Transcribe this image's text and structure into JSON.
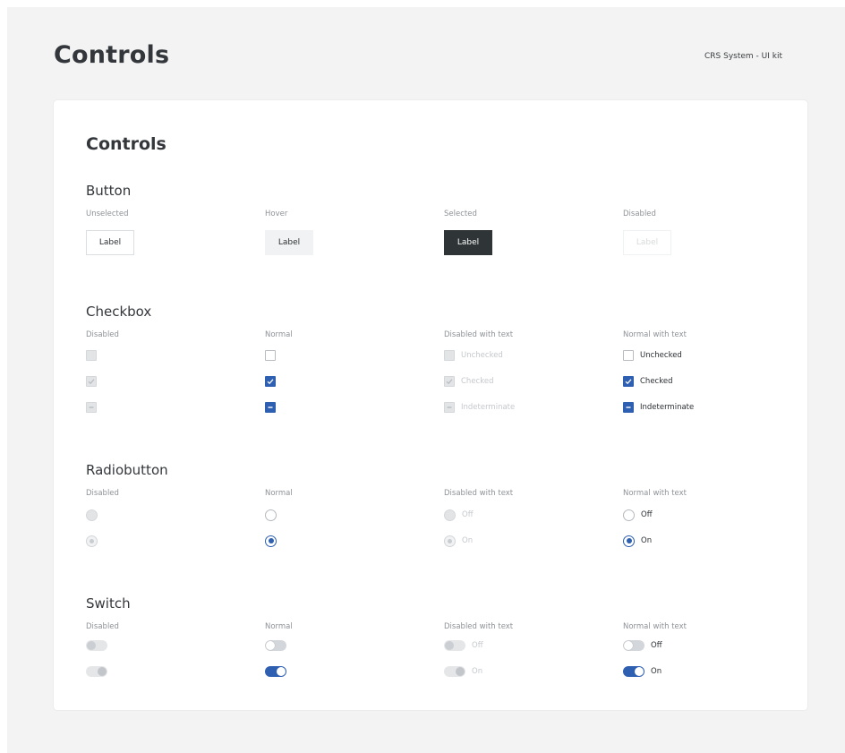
{
  "header": {
    "title": "Controls",
    "kit": "CRS System - UI kit"
  },
  "card": {
    "title": "Controls"
  },
  "button_section": {
    "title": "Button",
    "columns": [
      {
        "label": "Unselected",
        "button": "Label"
      },
      {
        "label": "Hover",
        "button": "Label"
      },
      {
        "label": "Selected",
        "button": "Label"
      },
      {
        "label": "Disabled",
        "button": "Label"
      }
    ]
  },
  "checkbox_section": {
    "title": "Checkbox",
    "columns": [
      "Disabled",
      "Normal",
      "Disabled with text",
      "Normal with text"
    ],
    "states": [
      "Unchecked",
      "Checked",
      "Indeterminate"
    ]
  },
  "radio_section": {
    "title": "Radiobutton",
    "columns": [
      "Disabled",
      "Normal",
      "Disabled with text",
      "Normal with text"
    ],
    "states": [
      "Off",
      "On"
    ]
  },
  "switch_section": {
    "title": "Switch",
    "columns": [
      "Disabled",
      "Normal",
      "Disabled with text",
      "Normal with text"
    ],
    "states": [
      "Off",
      "On"
    ]
  },
  "colors": {
    "accent": "#2e5fb0",
    "selected_button": "#2f3437",
    "page_background": "#f3f3f3"
  }
}
